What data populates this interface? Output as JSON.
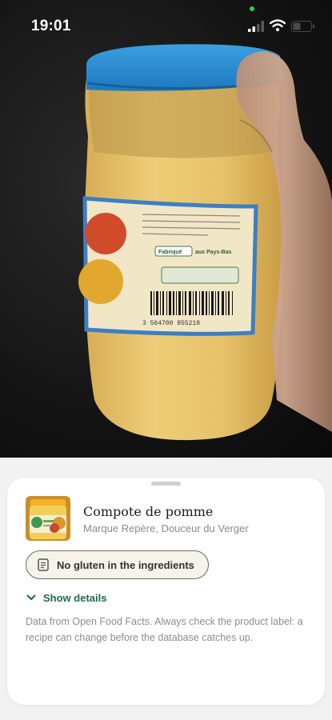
{
  "status_bar": {
    "time": "19:01"
  },
  "camera": {
    "label_lines": {
      "made_in_label": "Fabriqué",
      "made_in_country": "aux Pays-Bas",
      "barcode_number": "3 564700 855218"
    }
  },
  "product": {
    "title": "Compote de pomme",
    "brand": "Marque Repère, Douceur du Verger"
  },
  "verdict": {
    "label": "No gluten in the ingredients",
    "icon": "document-icon"
  },
  "details": {
    "label": "Show details",
    "icon": "chevron-down-icon"
  },
  "disclaimer": "Data from Open Food Facts. Always check the product label: a recipe can change before the database catches up.",
  "colors": {
    "accent_green": "#1e6b45",
    "pill_border": "#6e6a60",
    "jar_lid": "#2f8fd4",
    "applesauce": "#e8c46a"
  }
}
